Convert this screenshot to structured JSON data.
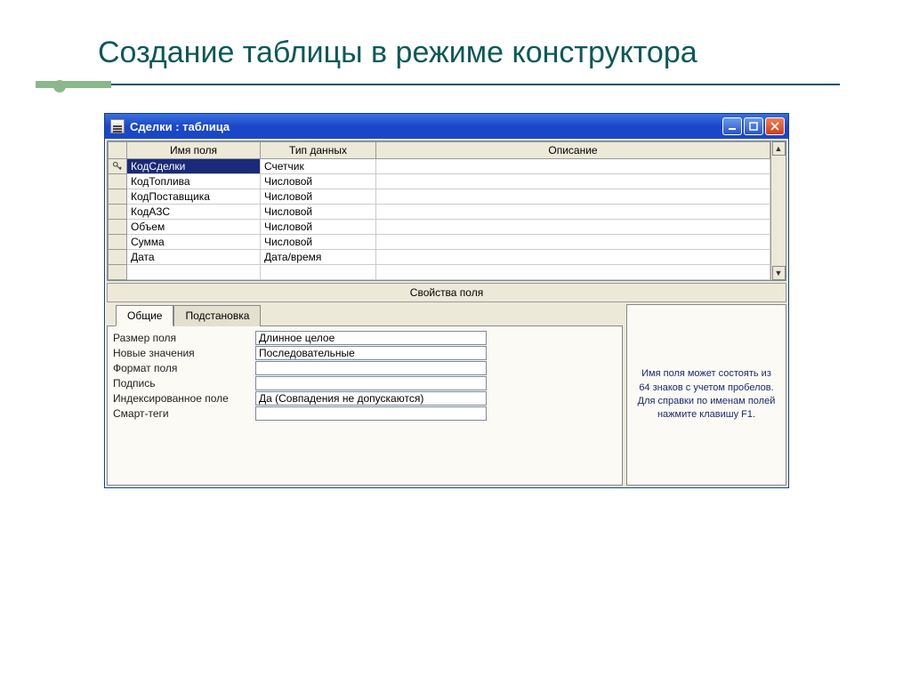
{
  "slide": {
    "title": "Создание таблицы в режиме конструктора"
  },
  "window": {
    "title": "Сделки : таблица"
  },
  "grid": {
    "headers": {
      "name": "Имя поля",
      "type": "Тип данных",
      "desc": "Описание"
    },
    "rows": [
      {
        "key": true,
        "selected": true,
        "name": "КодСделки",
        "type": "Счетчик",
        "desc": ""
      },
      {
        "key": false,
        "selected": false,
        "name": "КодТоплива",
        "type": "Числовой",
        "desc": ""
      },
      {
        "key": false,
        "selected": false,
        "name": "КодПоставщика",
        "type": "Числовой",
        "desc": ""
      },
      {
        "key": false,
        "selected": false,
        "name": "КодАЗС",
        "type": "Числовой",
        "desc": ""
      },
      {
        "key": false,
        "selected": false,
        "name": "Объем",
        "type": "Числовой",
        "desc": ""
      },
      {
        "key": false,
        "selected": false,
        "name": "Сумма",
        "type": "Числовой",
        "desc": ""
      },
      {
        "key": false,
        "selected": false,
        "name": "Дата",
        "type": "Дата/время",
        "desc": ""
      },
      {
        "key": false,
        "selected": false,
        "name": "",
        "type": "",
        "desc": ""
      }
    ]
  },
  "props_section_title": "Свойства поля",
  "tabs": {
    "general": "Общие",
    "lookup": "Подстановка"
  },
  "props": [
    {
      "label": "Размер поля",
      "value": "Длинное целое"
    },
    {
      "label": "Новые значения",
      "value": "Последовательные"
    },
    {
      "label": "Формат поля",
      "value": ""
    },
    {
      "label": "Подпись",
      "value": ""
    },
    {
      "label": "Индексированное поле",
      "value": "Да (Совпадения не допускаются)"
    },
    {
      "label": "Смарт-теги",
      "value": ""
    }
  ],
  "help_text": "Имя поля может состоять из 64 знаков с учетом пробелов.  Для справки по именам полей нажмите клавишу F1."
}
